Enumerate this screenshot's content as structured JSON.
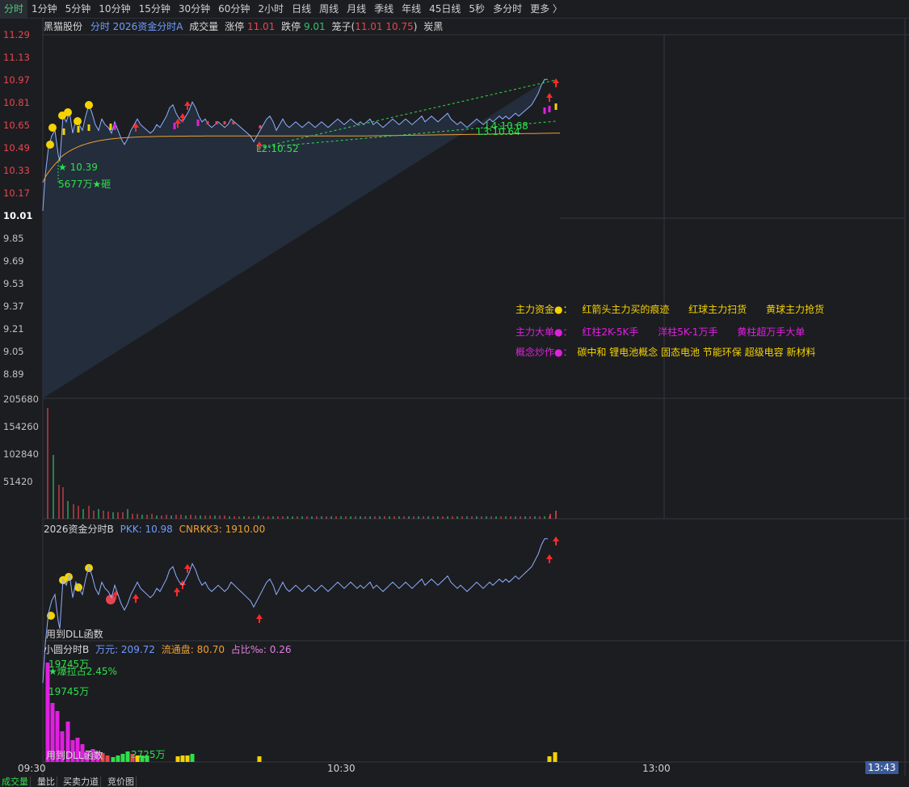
{
  "toolbar": {
    "tabs": [
      "分时",
      "1分钟",
      "5分钟",
      "10分钟",
      "15分钟",
      "30分钟",
      "60分钟",
      "2小时",
      "日线",
      "周线",
      "月线",
      "季线",
      "年线",
      "45日线",
      "5秒",
      "多分时",
      "更多 〉"
    ],
    "active_index": 0
  },
  "main_info": {
    "stock": "黑猫股份",
    "indicator": "分时 2026资金分时A",
    "volume_label": "成交量",
    "limit_up_label": "涨停",
    "limit_up_value": "11.01",
    "limit_down_label": "跌停",
    "limit_down_value": "9.01",
    "zhuzi_label": "笼子(",
    "zhuzi_v1": "11.01",
    "zhuzi_v2": "10.75",
    "zhuzi_end": ")",
    "concept": "炭黑"
  },
  "price_axis": [
    {
      "v": "11.29",
      "c": "red"
    },
    {
      "v": "11.13",
      "c": "red"
    },
    {
      "v": "10.97",
      "c": "red"
    },
    {
      "v": "10.81",
      "c": "red"
    },
    {
      "v": "10.65",
      "c": "red"
    },
    {
      "v": "10.49",
      "c": "red"
    },
    {
      "v": "10.33",
      "c": "red"
    },
    {
      "v": "10.17",
      "c": "red"
    },
    {
      "v": "10.01",
      "c": "white"
    },
    {
      "v": "9.85",
      "c": "gray"
    },
    {
      "v": "9.69",
      "c": "gray"
    },
    {
      "v": "9.53",
      "c": "gray"
    },
    {
      "v": "9.37",
      "c": "gray"
    },
    {
      "v": "9.21",
      "c": "gray"
    },
    {
      "v": "9.05",
      "c": "gray"
    },
    {
      "v": "8.89",
      "c": "gray"
    }
  ],
  "volume_axis": [
    "205680",
    "154260",
    "102840",
    "51420"
  ],
  "price_annotations": {
    "low1": "★ 10.39",
    "amount1": "5677万★砸",
    "l2": "L2:10.52",
    "l3": "L3:10.64",
    "l4": "L4:10.68"
  },
  "legend": {
    "row1_title": "主力资金●：",
    "row1_items": [
      "红箭头主力买的痕迹",
      "红球主力扫货",
      "黄球主力抢货"
    ],
    "row2_title": "主力大单●：",
    "row2_items": [
      "红柱2K-5K手",
      "洋柱5K-1万手",
      "黄柱超万手大单"
    ],
    "row3_title": "概念炒作●：",
    "row3_text": "碳中和 锂电池概念 固态电池 节能环保 超级电容 新材料"
  },
  "panel_b": {
    "name": "2026资金分时B",
    "pkk_label": "PKK: ",
    "pkk_value": "10.98",
    "cnrkk_label": "CNRKK3: ",
    "cnrkk_value": "1910.00",
    "dll_note": "用到DLL函数"
  },
  "panel_c": {
    "name": "小圆分时B",
    "wan_label": "万元: ",
    "wan_value": "209.72",
    "float_label": "流通盘: ",
    "float_value": "80.70",
    "ratio_label": "占比‰: ",
    "ratio_value": "0.26",
    "top_amount": "19745万",
    "explode_label": "★爆拉占2.45%",
    "amount2": "19745万",
    "amount3": "2725万",
    "dll_note": "用到DLL函数"
  },
  "time_axis": [
    "09:30",
    "10:30",
    "13:00"
  ],
  "time_cursor": "13:43",
  "bottom_tabs": [
    "成交量",
    "量比",
    "买卖力道",
    "竞价图"
  ],
  "colors": {
    "up": "#e9454f",
    "down": "#33c36a",
    "price_line": "#8fb0ff",
    "avg_line": "#f0a030",
    "yellow": "#f5d300",
    "magenta": "#e020e0",
    "green_text": "#2ee04a"
  }
}
